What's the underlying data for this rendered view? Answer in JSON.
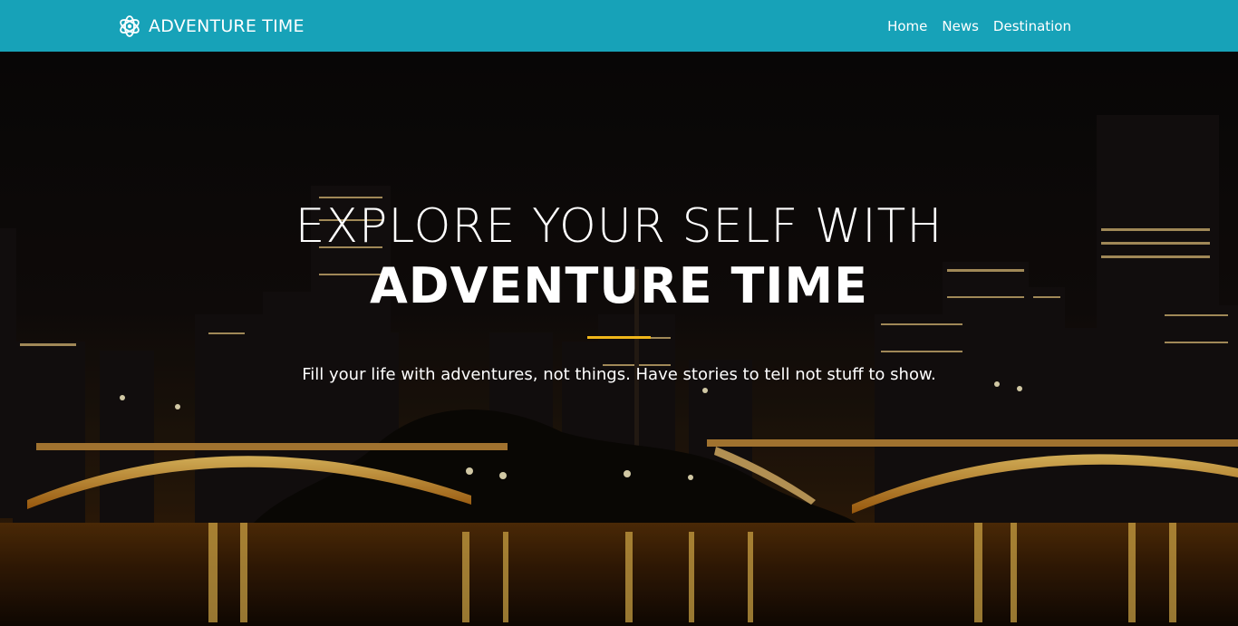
{
  "navbar": {
    "brand_text": "ADVENTURE TIME",
    "brand_icon": "atom-star-icon",
    "links": [
      {
        "label": "Home"
      },
      {
        "label": "News"
      },
      {
        "label": "Destination"
      }
    ],
    "background_color": "#17a2b8"
  },
  "hero": {
    "line1": "EXPLORE YOUR SELF WITH",
    "line2": "ADVENTURE TIME",
    "tagline": "Fill your life with adventures, not things. Have stories to tell not stuff to show.",
    "divider_color": "#f0b61a",
    "background_image": "night city skyline with illuminated bridge over river"
  }
}
